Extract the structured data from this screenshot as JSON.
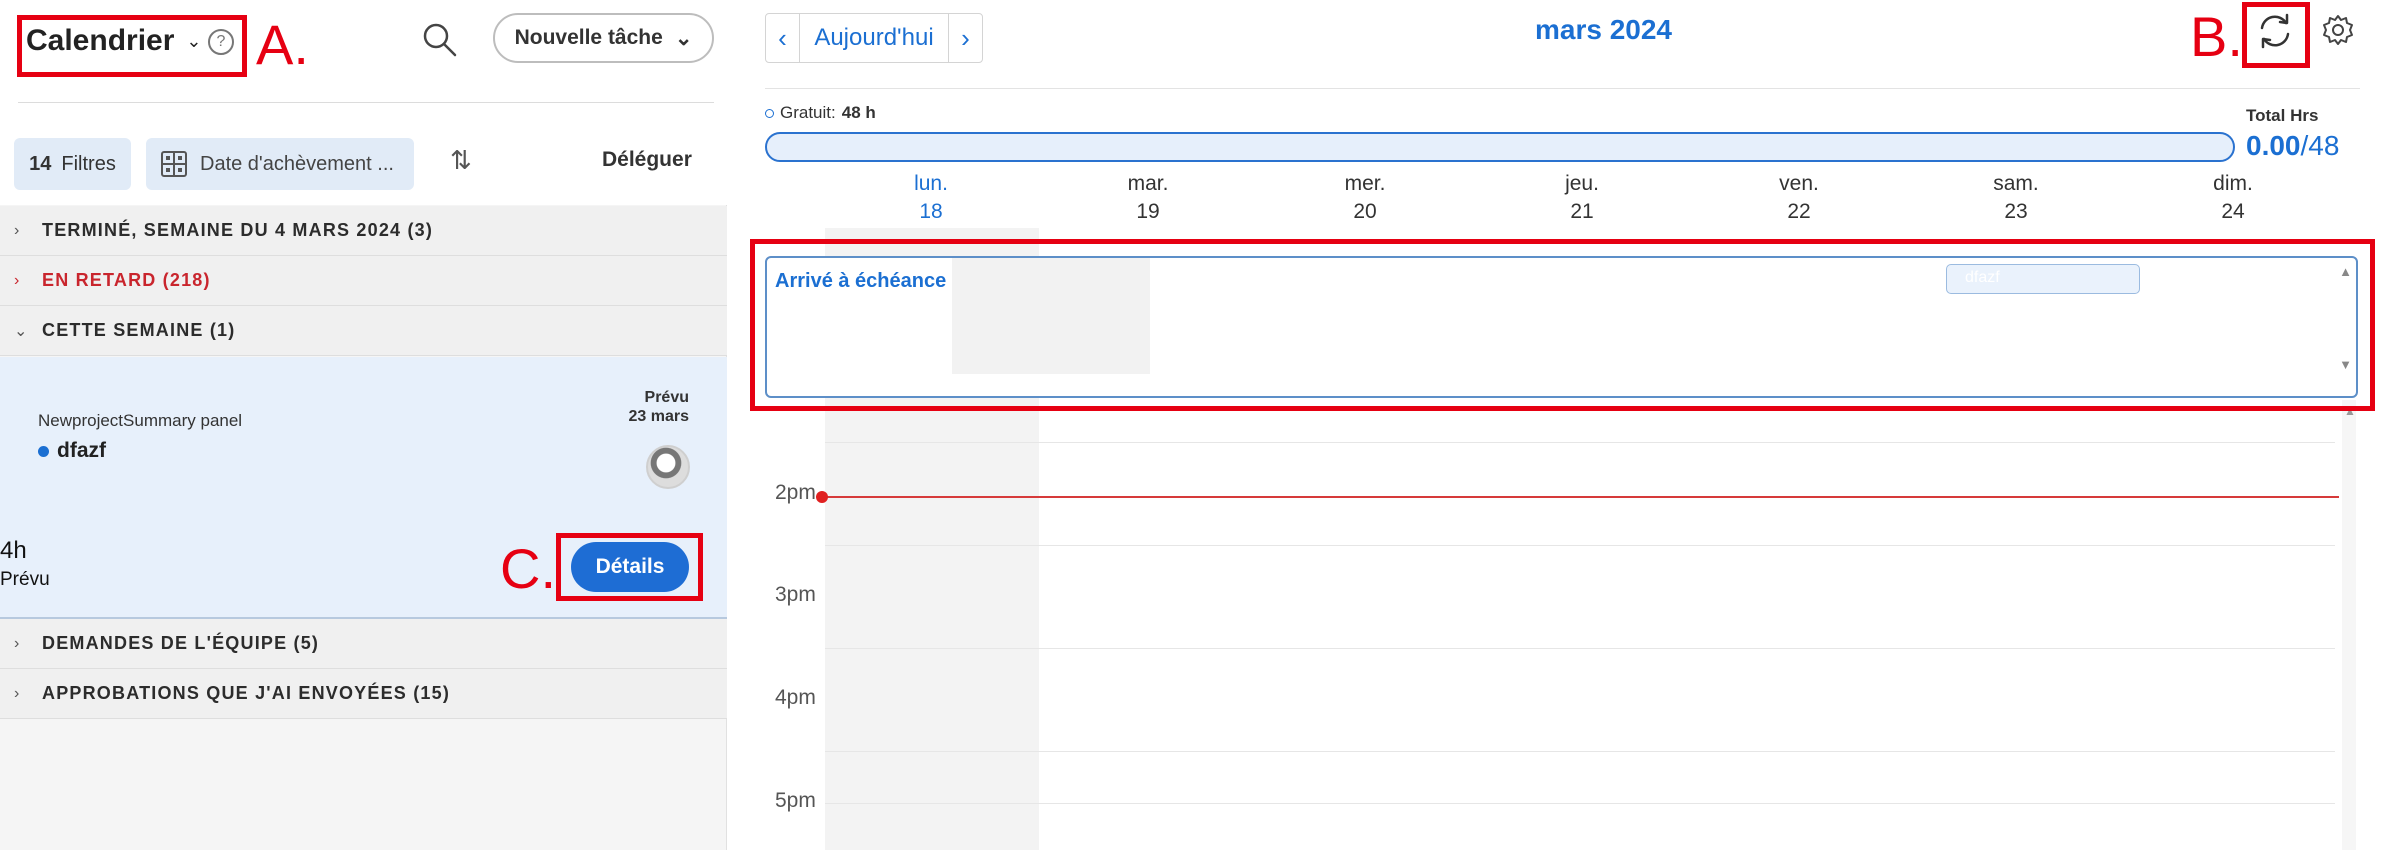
{
  "sidebar": {
    "title": "Calendrier",
    "new_task_label": "Nouvelle tâche",
    "filters_count": "14",
    "filters_label": "Filtres",
    "sort_label": "Date d'achèvement ...",
    "delegate_label": "Déléguer",
    "sections": [
      {
        "label": "TERMINÉ, SEMAINE DU 4 MARS 2024 (3)",
        "expanded": false,
        "color": "#2c2c2c"
      },
      {
        "label": "EN RETARD (218)",
        "expanded": false,
        "color": "#c9252d"
      },
      {
        "label": "CETTE SEMAINE (1)",
        "expanded": true,
        "color": "#2c2c2c"
      },
      {
        "label": "DEMANDES DE L'ÉQUIPE (5)",
        "expanded": false,
        "color": "#2c2c2c"
      },
      {
        "label": "APPROBATIONS QUE J'AI ENVOYÉES (15)",
        "expanded": false,
        "color": "#2c2c2c"
      }
    ],
    "card": {
      "project": "NewprojectSummary panel",
      "task": "dfazf",
      "planned_label": "Prévu",
      "planned_date": "23 mars",
      "hours": "4h",
      "hours_label": "Prévu",
      "details_label": "Détails"
    }
  },
  "calendar": {
    "today_label": "Aujourd'hui",
    "month_title": "mars 2024",
    "capacity_label": "Gratuit:",
    "capacity_value": "48 h",
    "total_hrs_label": "Total Hrs",
    "total_used": "0.00",
    "total_capacity": "/48",
    "days": [
      {
        "name": "lun.",
        "num": "18",
        "today": true
      },
      {
        "name": "mar.",
        "num": "19",
        "today": false
      },
      {
        "name": "mer.",
        "num": "20",
        "today": false
      },
      {
        "name": "jeu.",
        "num": "21",
        "today": false
      },
      {
        "name": "ven.",
        "num": "22",
        "today": false
      },
      {
        "name": "sam.",
        "num": "23",
        "today": false
      },
      {
        "name": "dim.",
        "num": "24",
        "today": false
      }
    ],
    "due_title": "Arrivé à échéance",
    "due_chip": "dfazf",
    "hours": [
      "2pm",
      "3pm",
      "4pm",
      "5pm"
    ]
  },
  "annotations": {
    "a": "A.",
    "b": "B.",
    "c": "C."
  },
  "colors": {
    "accent": "#1b6fd2",
    "annotation": "#e60012",
    "overdue": "#c9252d",
    "now_line": "#d63a3a"
  }
}
